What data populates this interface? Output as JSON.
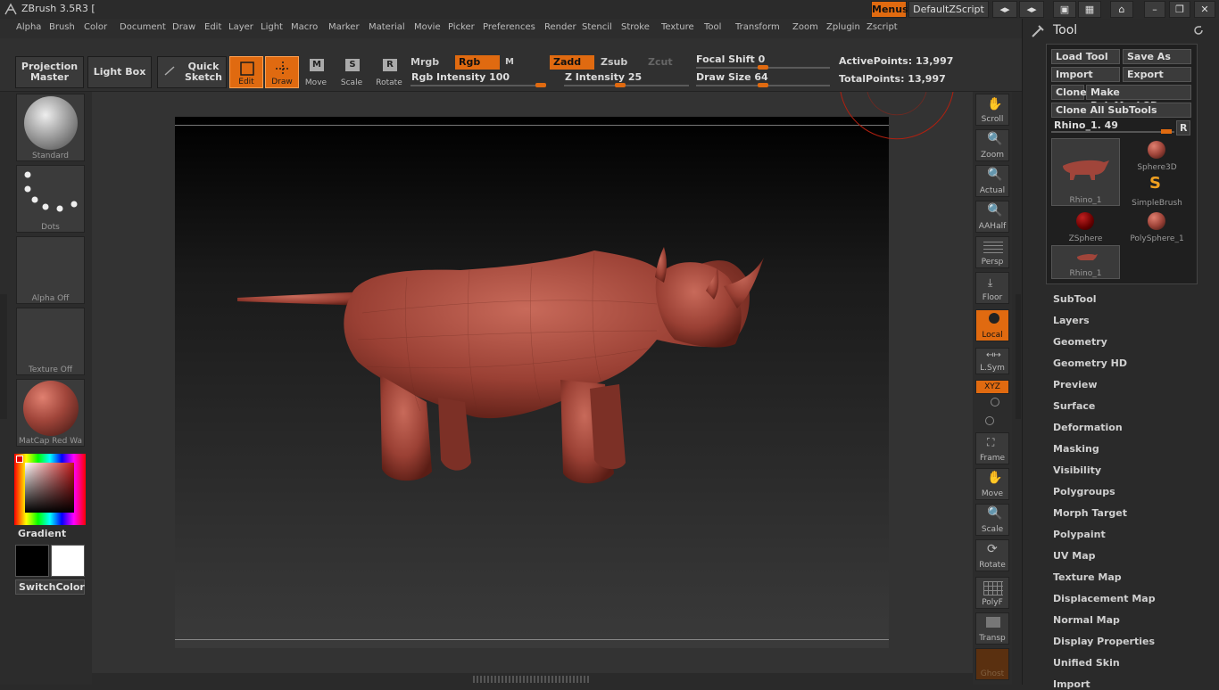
{
  "app": {
    "title": "ZBrush 3.5R3 ["
  },
  "titlebar": {
    "menus_label": "Menus",
    "script_label": "DefaultZScript"
  },
  "menubar": {
    "items": [
      "Alpha",
      "Brush",
      "Color",
      "Document",
      "Draw",
      "Edit",
      "Layer",
      "Light",
      "Macro",
      "Marker",
      "Material",
      "Movie",
      "Picker",
      "Preferences",
      "Render",
      "Stencil",
      "Stroke",
      "Texture",
      "Tool",
      "Transform",
      "Zoom",
      "Zplugin",
      "Zscript"
    ]
  },
  "toolbar": {
    "projection_master": "Projection Master",
    "light_box": "Light Box",
    "quick_sketch": "Quick Sketch",
    "edit": "Edit",
    "draw": "Draw",
    "move": "Move",
    "scale": "Scale",
    "rotate": "Rotate",
    "mrgb": "Mrgb",
    "rgb": "Rgb",
    "m": "M",
    "zadd": "Zadd",
    "zsub": "Zsub",
    "zcut": "Zcut",
    "rgb_intensity": "Rgb Intensity 100",
    "z_intensity": "Z Intensity 25",
    "focal_shift": "Focal Shift 0",
    "draw_size": "Draw Size 64",
    "active_points": "ActivePoints: 13,997",
    "total_points": "TotalPoints: 13,997"
  },
  "left": {
    "brush_name": "Standard",
    "stroke_name": "Dots",
    "alpha_name": "Alpha Off",
    "texture_name": "Texture Off",
    "material_name": "MatCap Red Wa",
    "gradient_label": "Gradient",
    "switch_color": "SwitchColor"
  },
  "shelf": {
    "scroll": "Scroll",
    "zoom": "Zoom",
    "actual": "Actual",
    "aahalf": "AAHalf",
    "persp": "Persp",
    "floor": "Floor",
    "local": "Local",
    "lsym": "L.Sym",
    "xyz": "XYZ",
    "frame": "Frame",
    "move": "Move",
    "scale": "Scale",
    "rotate": "Rotate",
    "polyf": "PolyF",
    "transp": "Transp",
    "ghost": "Ghost"
  },
  "tool": {
    "title": "Tool",
    "load_tool": "Load Tool",
    "save_as": "Save As",
    "import": "Import",
    "export": "Export",
    "clone": "Clone",
    "make_polymesh": "Make PolyMesh3D",
    "clone_all": "Clone All SubTools",
    "current": "Rhino_1. 49",
    "r": "R",
    "thumbs": [
      "Rhino_1",
      "Sphere3D",
      "SimpleBrush",
      "ZSphere",
      "PolySphere_1",
      "Rhino_1"
    ],
    "sections": [
      "SubTool",
      "Layers",
      "Geometry",
      "Geometry HD",
      "Preview",
      "Surface",
      "Deformation",
      "Masking",
      "Visibility",
      "Polygroups",
      "Morph Target",
      "Polypaint",
      "UV Map",
      "Texture Map",
      "Displacement Map",
      "Normal Map",
      "Display Properties",
      "Unified Skin",
      "Import"
    ]
  },
  "colors": {
    "accent": "#e06a10",
    "model": "#a0453a"
  }
}
